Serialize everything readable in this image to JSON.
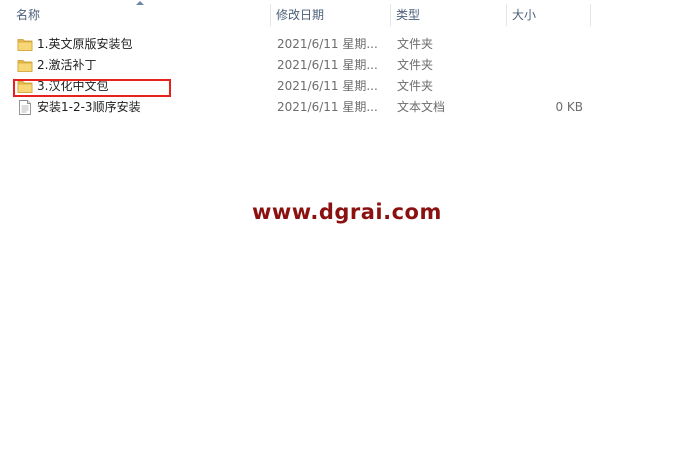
{
  "columns": {
    "name": "名称",
    "date": "修改日期",
    "type": "类型",
    "size": "大小"
  },
  "files": [
    {
      "name": "1.英文原版安装包",
      "date": "2021/6/11 星期...",
      "type": "文件夹",
      "size": "",
      "icon": "folder-icon"
    },
    {
      "name": "2.激活补丁",
      "date": "2021/6/11 星期...",
      "type": "文件夹",
      "size": "",
      "icon": "folder-icon"
    },
    {
      "name": "3.汉化中文包",
      "date": "2021/6/11 星期...",
      "type": "文件夹",
      "size": "",
      "icon": "folder-icon"
    },
    {
      "name": "安装1-2-3顺序安装",
      "date": "2021/6/11 星期...",
      "type": "文本文档",
      "size": "0 KB",
      "icon": "text-document-icon"
    }
  ],
  "watermark": "www.dgrai.com",
  "colors": {
    "highlight_border": "#e8201e",
    "watermark": "#8b1111",
    "header_text": "#4c607a"
  }
}
